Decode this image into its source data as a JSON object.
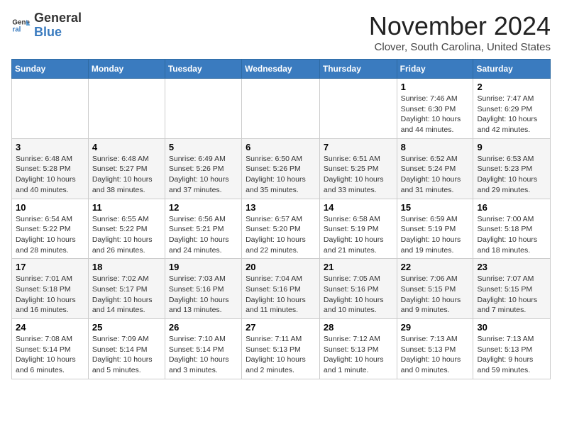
{
  "logo": {
    "line1": "General",
    "line2": "Blue"
  },
  "title": "November 2024",
  "location": "Clover, South Carolina, United States",
  "weekdays": [
    "Sunday",
    "Monday",
    "Tuesday",
    "Wednesday",
    "Thursday",
    "Friday",
    "Saturday"
  ],
  "weeks": [
    [
      {
        "day": "",
        "info": ""
      },
      {
        "day": "",
        "info": ""
      },
      {
        "day": "",
        "info": ""
      },
      {
        "day": "",
        "info": ""
      },
      {
        "day": "",
        "info": ""
      },
      {
        "day": "1",
        "info": "Sunrise: 7:46 AM\nSunset: 6:30 PM\nDaylight: 10 hours and 44 minutes."
      },
      {
        "day": "2",
        "info": "Sunrise: 7:47 AM\nSunset: 6:29 PM\nDaylight: 10 hours and 42 minutes."
      }
    ],
    [
      {
        "day": "3",
        "info": "Sunrise: 6:48 AM\nSunset: 5:28 PM\nDaylight: 10 hours and 40 minutes."
      },
      {
        "day": "4",
        "info": "Sunrise: 6:48 AM\nSunset: 5:27 PM\nDaylight: 10 hours and 38 minutes."
      },
      {
        "day": "5",
        "info": "Sunrise: 6:49 AM\nSunset: 5:26 PM\nDaylight: 10 hours and 37 minutes."
      },
      {
        "day": "6",
        "info": "Sunrise: 6:50 AM\nSunset: 5:26 PM\nDaylight: 10 hours and 35 minutes."
      },
      {
        "day": "7",
        "info": "Sunrise: 6:51 AM\nSunset: 5:25 PM\nDaylight: 10 hours and 33 minutes."
      },
      {
        "day": "8",
        "info": "Sunrise: 6:52 AM\nSunset: 5:24 PM\nDaylight: 10 hours and 31 minutes."
      },
      {
        "day": "9",
        "info": "Sunrise: 6:53 AM\nSunset: 5:23 PM\nDaylight: 10 hours and 29 minutes."
      }
    ],
    [
      {
        "day": "10",
        "info": "Sunrise: 6:54 AM\nSunset: 5:22 PM\nDaylight: 10 hours and 28 minutes."
      },
      {
        "day": "11",
        "info": "Sunrise: 6:55 AM\nSunset: 5:22 PM\nDaylight: 10 hours and 26 minutes."
      },
      {
        "day": "12",
        "info": "Sunrise: 6:56 AM\nSunset: 5:21 PM\nDaylight: 10 hours and 24 minutes."
      },
      {
        "day": "13",
        "info": "Sunrise: 6:57 AM\nSunset: 5:20 PM\nDaylight: 10 hours and 22 minutes."
      },
      {
        "day": "14",
        "info": "Sunrise: 6:58 AM\nSunset: 5:19 PM\nDaylight: 10 hours and 21 minutes."
      },
      {
        "day": "15",
        "info": "Sunrise: 6:59 AM\nSunset: 5:19 PM\nDaylight: 10 hours and 19 minutes."
      },
      {
        "day": "16",
        "info": "Sunrise: 7:00 AM\nSunset: 5:18 PM\nDaylight: 10 hours and 18 minutes."
      }
    ],
    [
      {
        "day": "17",
        "info": "Sunrise: 7:01 AM\nSunset: 5:18 PM\nDaylight: 10 hours and 16 minutes."
      },
      {
        "day": "18",
        "info": "Sunrise: 7:02 AM\nSunset: 5:17 PM\nDaylight: 10 hours and 14 minutes."
      },
      {
        "day": "19",
        "info": "Sunrise: 7:03 AM\nSunset: 5:16 PM\nDaylight: 10 hours and 13 minutes."
      },
      {
        "day": "20",
        "info": "Sunrise: 7:04 AM\nSunset: 5:16 PM\nDaylight: 10 hours and 11 minutes."
      },
      {
        "day": "21",
        "info": "Sunrise: 7:05 AM\nSunset: 5:16 PM\nDaylight: 10 hours and 10 minutes."
      },
      {
        "day": "22",
        "info": "Sunrise: 7:06 AM\nSunset: 5:15 PM\nDaylight: 10 hours and 9 minutes."
      },
      {
        "day": "23",
        "info": "Sunrise: 7:07 AM\nSunset: 5:15 PM\nDaylight: 10 hours and 7 minutes."
      }
    ],
    [
      {
        "day": "24",
        "info": "Sunrise: 7:08 AM\nSunset: 5:14 PM\nDaylight: 10 hours and 6 minutes."
      },
      {
        "day": "25",
        "info": "Sunrise: 7:09 AM\nSunset: 5:14 PM\nDaylight: 10 hours and 5 minutes."
      },
      {
        "day": "26",
        "info": "Sunrise: 7:10 AM\nSunset: 5:14 PM\nDaylight: 10 hours and 3 minutes."
      },
      {
        "day": "27",
        "info": "Sunrise: 7:11 AM\nSunset: 5:13 PM\nDaylight: 10 hours and 2 minutes."
      },
      {
        "day": "28",
        "info": "Sunrise: 7:12 AM\nSunset: 5:13 PM\nDaylight: 10 hours and 1 minute."
      },
      {
        "day": "29",
        "info": "Sunrise: 7:13 AM\nSunset: 5:13 PM\nDaylight: 10 hours and 0 minutes."
      },
      {
        "day": "30",
        "info": "Sunrise: 7:13 AM\nSunset: 5:13 PM\nDaylight: 9 hours and 59 minutes."
      }
    ]
  ]
}
